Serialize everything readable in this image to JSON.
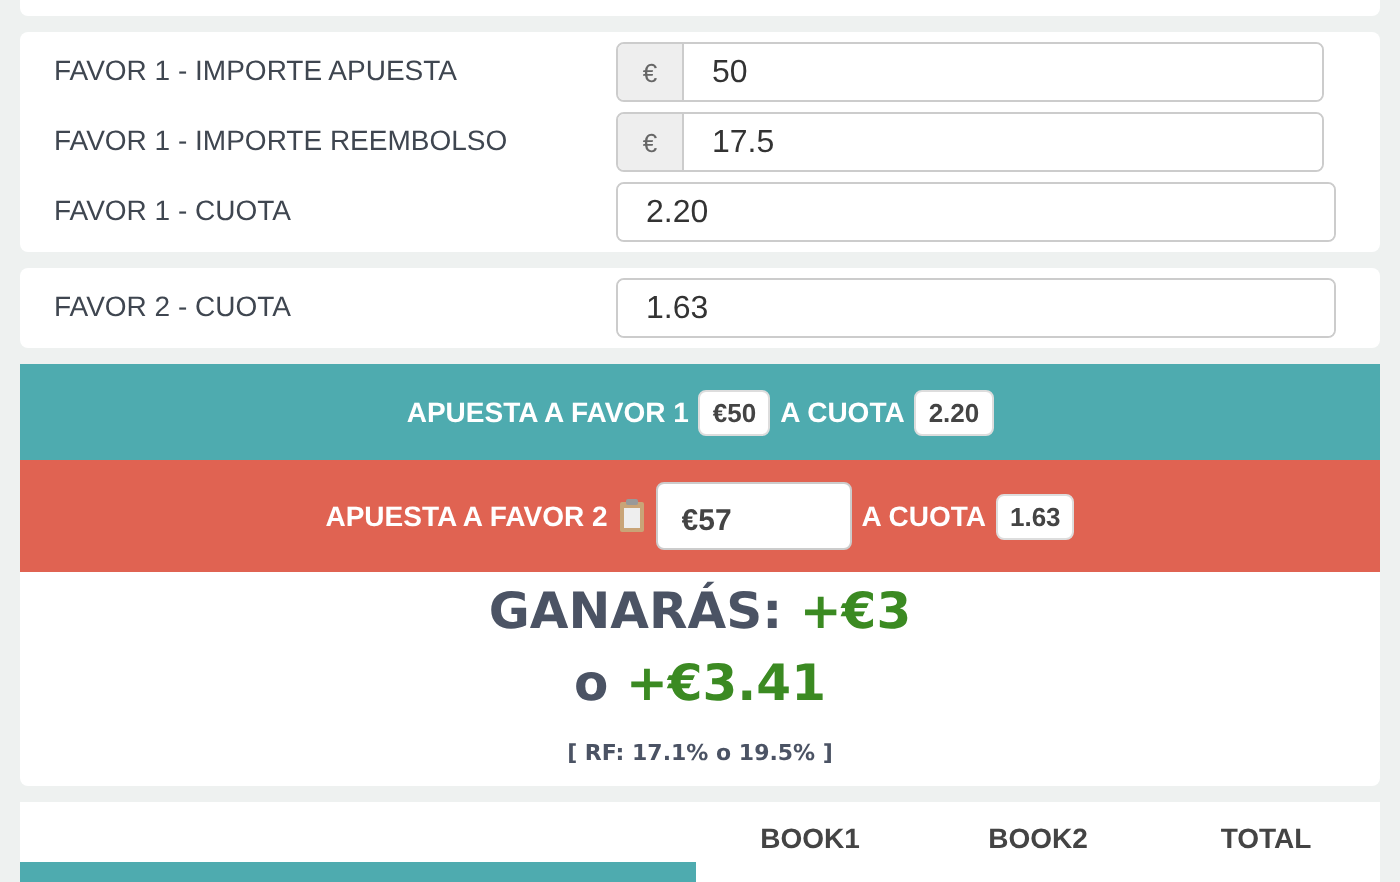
{
  "cards": [
    {
      "fields": [
        {
          "label": "FAVOR 1 - IMPORTE APUESTA",
          "prefix": "€",
          "value": "50"
        },
        {
          "label": "FAVOR 1 - IMPORTE REEMBOLSO",
          "prefix": "€",
          "value": "17.5"
        },
        {
          "label": "FAVOR 1 - CUOTA",
          "value": "2.20"
        }
      ]
    },
    {
      "fields": [
        {
          "label": "FAVOR 2 - CUOTA",
          "value": "1.63"
        }
      ]
    }
  ],
  "bets": [
    {
      "kind": "static",
      "label": "APUESTA A FAVOR 1",
      "amount": "€50",
      "odds_label": "A CUOTA",
      "odds": "2.20",
      "color": "#4eabaf"
    },
    {
      "kind": "input",
      "label": "APUESTA A FAVOR 2",
      "amount": "€57",
      "odds_label": "A CUOTA",
      "odds": "1.63",
      "color": "#e06352"
    }
  ],
  "result": {
    "label": "GANARÁS:",
    "profit": "+€3",
    "or": "o",
    "alt_profit": "+€3.41",
    "rf": "[ RF: 17.1% o 19.5% ]"
  },
  "table": {
    "columns": [
      "BOOK1",
      "BOOK2",
      "TOTAL"
    ]
  }
}
